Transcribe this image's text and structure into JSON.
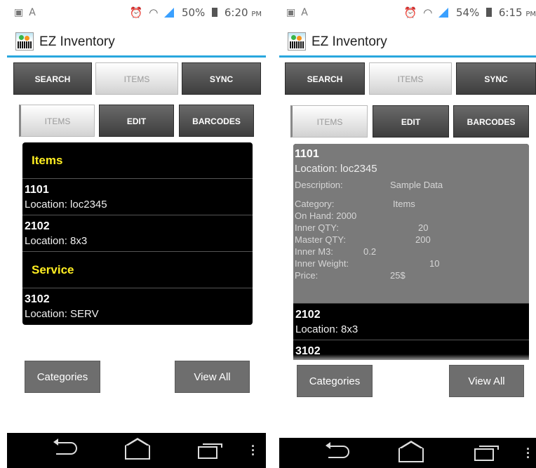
{
  "left": {
    "status": {
      "icons_left": [
        "screenshot-icon",
        "font-icon"
      ],
      "battery": "50%",
      "time": "6:20",
      "ampm": "PM"
    },
    "app_title": "EZ Inventory",
    "top_tabs": [
      "SEARCH",
      "ITEMS",
      "SYNC"
    ],
    "sub_tabs": [
      "ITEMS",
      "EDIT",
      "BARCODES"
    ],
    "list": {
      "sections": [
        {
          "header": "Items",
          "items": [
            {
              "code": "1101",
              "location": "Location: loc2345"
            },
            {
              "code": "2102",
              "location": "Location: 8x3"
            }
          ]
        },
        {
          "header": "Service",
          "items": [
            {
              "code": "3102",
              "location": "Location: SERV"
            }
          ]
        }
      ]
    },
    "buttons": {
      "categories": "Categories",
      "view_all": "View All"
    }
  },
  "right": {
    "status": {
      "battery": "54%",
      "time": "6:15",
      "ampm": "PM"
    },
    "app_title": "EZ Inventory",
    "top_tabs": [
      "SEARCH",
      "ITEMS",
      "SYNC"
    ],
    "sub_tabs": [
      "ITEMS",
      "EDIT",
      "BARCODES"
    ],
    "expanded": {
      "code": "1101",
      "location": "Location: loc2345",
      "description_label": "Description:",
      "description_value": "Sample Data",
      "category_label": "Category:",
      "category_value": "Items",
      "on_hand": "On Hand: 2000",
      "inner_qty_label": "Inner QTY:",
      "inner_qty_value": "20",
      "master_qty_label": "Master QTY:",
      "master_qty_value": "200",
      "inner_m3_label": "Inner M3:",
      "inner_m3_value": "0.2",
      "inner_weight_label": "Inner Weight:",
      "inner_weight_value": "10",
      "price_label": "Price:",
      "price_value": "25$"
    },
    "rows": [
      {
        "code": "2102",
        "location": "Location: 8x3"
      },
      {
        "code": "3102",
        "location": ""
      }
    ],
    "buttons": {
      "categories": "Categories",
      "view_all": "View All"
    }
  },
  "colors": {
    "accent": "#29a7de",
    "section_header": "#ffee22",
    "list_bg": "#000000",
    "detail_bg": "#7a7a7a",
    "button": "#6e6e6e"
  }
}
